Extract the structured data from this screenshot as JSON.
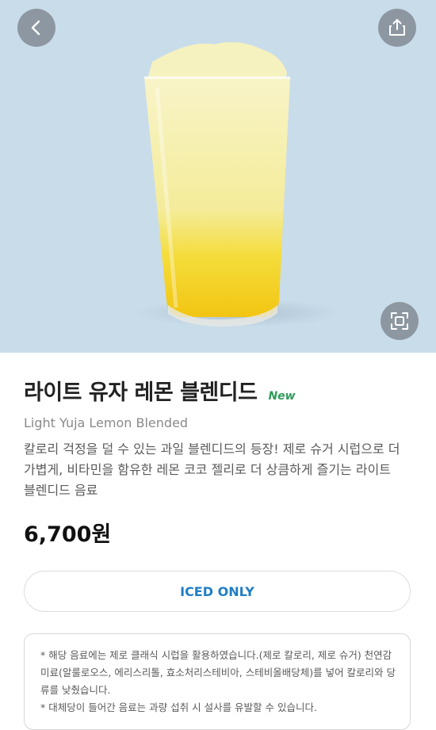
{
  "product": {
    "name": "라이트 유자 레몬 블렌디드",
    "badge": "New",
    "name_en": "Light Yuja Lemon Blended",
    "description": "칼로리 걱정을 덜 수 있는 과일 블렌디드의 등장! 제로 슈거 시럽으로 더 가볍게, 비타민을 함유한 레몬 코코 젤리로 더 상큼하게 즐기는 라이트 블렌디드 음료",
    "price": "6,700원",
    "temperature_option": "ICED ONLY"
  },
  "notice": {
    "line1": "* 해당 음료에는 제로 클래식 시럽을 활용하였습니다.(제로 칼로리, 제로 슈거) 천연감미료(알룰로오스, 에리스리톨, 효소처리스테비아, 스테비올배당체)를 넣어 칼로리와 당류를 낮췄습니다.",
    "line2": "* 대체당이 들어간 음료는 과량 섭취 시 설사를 유발할 수 있습니다."
  },
  "icons": {
    "back": "chevron-left-icon",
    "share": "share-icon",
    "zoom": "expand-icon"
  },
  "colors": {
    "hero_background": "#c9dcea",
    "badge_green": "#2f9b5a",
    "accent_blue": "#1f7ec4"
  }
}
